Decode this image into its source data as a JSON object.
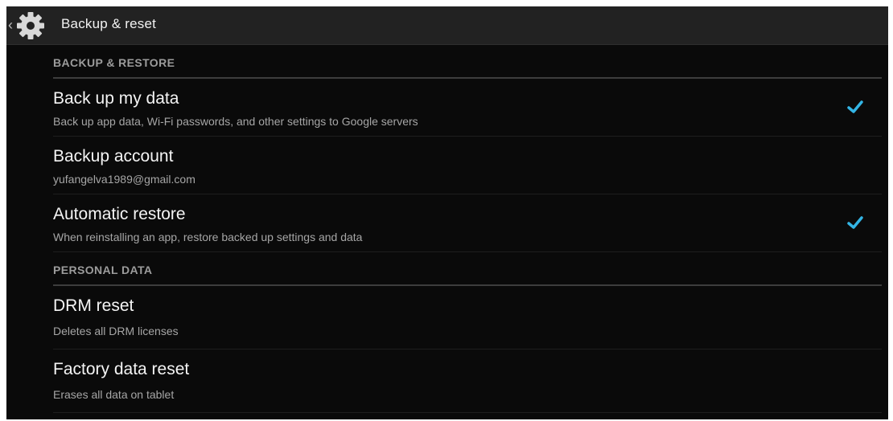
{
  "action_bar": {
    "title": "Backup & reset",
    "icon": "gear-icon",
    "up_indicator": "‹"
  },
  "sections": {
    "backup_restore": {
      "header": "BACKUP & RESTORE",
      "items": {
        "back_up_my_data": {
          "title": "Back up my data",
          "summary": "Back up app data, Wi-Fi passwords, and other settings to Google servers",
          "checked": true
        },
        "backup_account": {
          "title": "Backup account",
          "summary": "yufangelva1989@gmail.com"
        },
        "automatic_restore": {
          "title": "Automatic restore",
          "summary": "When reinstalling an app, restore backed up settings and data",
          "checked": true
        }
      }
    },
    "personal_data": {
      "header": "PERSONAL DATA",
      "items": {
        "drm_reset": {
          "title": "DRM reset",
          "summary": "Deletes all DRM licenses"
        },
        "factory_data_reset": {
          "title": "Factory data reset",
          "summary": "Erases all data on tablet"
        }
      }
    }
  },
  "colors": {
    "background": "#0a0a0a",
    "action_bar": "#222222",
    "accent_check": "#33b5e5",
    "title_text": "#f4f4f4",
    "summary_text": "#a6a6a6",
    "header_text": "#9c9c9c"
  }
}
